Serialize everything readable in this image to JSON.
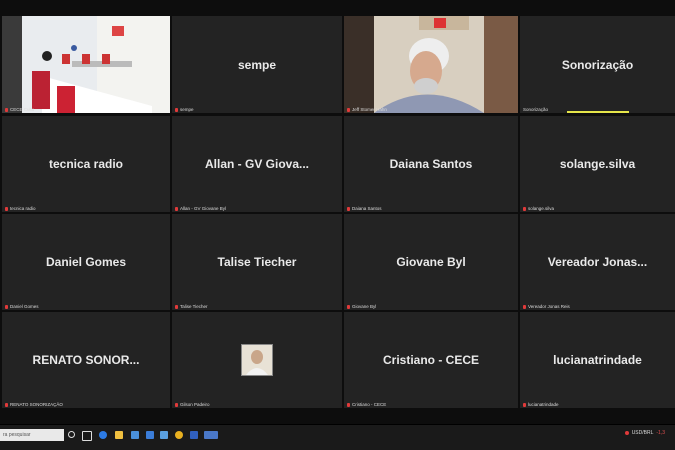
{
  "colors": {
    "tile_bg": "#232323",
    "active_border": "#e6e64a",
    "mic_muted": "#e03a3a"
  },
  "tiles": [
    {
      "label": "CECE Cultu",
      "big": "",
      "kind": "video-room"
    },
    {
      "label": "sempe",
      "big": "sempe"
    },
    {
      "label": "Jeff Stomer Hahn",
      "big": "",
      "kind": "video-person"
    },
    {
      "label": "Sonorização",
      "big": "Sonorização"
    },
    {
      "label": "tecnica radio",
      "big": "tecnica radio"
    },
    {
      "label": "Allan - GV Giovane Byl",
      "big": "Allan - GV Giova..."
    },
    {
      "label": "Daiana Santos",
      "big": "Daiana Santos"
    },
    {
      "label": "solange.silva",
      "big": "solange.silva"
    },
    {
      "label": "Daniel Gomes",
      "big": "Daniel Gomes"
    },
    {
      "label": "Talise Tiecher",
      "big": "Talise Tiecher"
    },
    {
      "label": "Giovane Byl",
      "big": "Giovane Byl"
    },
    {
      "label": "Vereador Jonas Reis",
      "big": "Vereador Jonas..."
    },
    {
      "label": "RENATO SONORIZAÇÃO",
      "big": "RENATO SONOR..."
    },
    {
      "label": "Gilson Padeiro",
      "big": "",
      "kind": "photo"
    },
    {
      "label": "Cristiano - CECE",
      "big": "Cristiano - CECE"
    },
    {
      "label": "lucianatrindade",
      "big": "lucianatrindade"
    }
  ],
  "taskbar": {
    "search_placeholder": "ra pesquisar",
    "tray_text": "USD/BRL",
    "tray_value": "-1,3"
  }
}
